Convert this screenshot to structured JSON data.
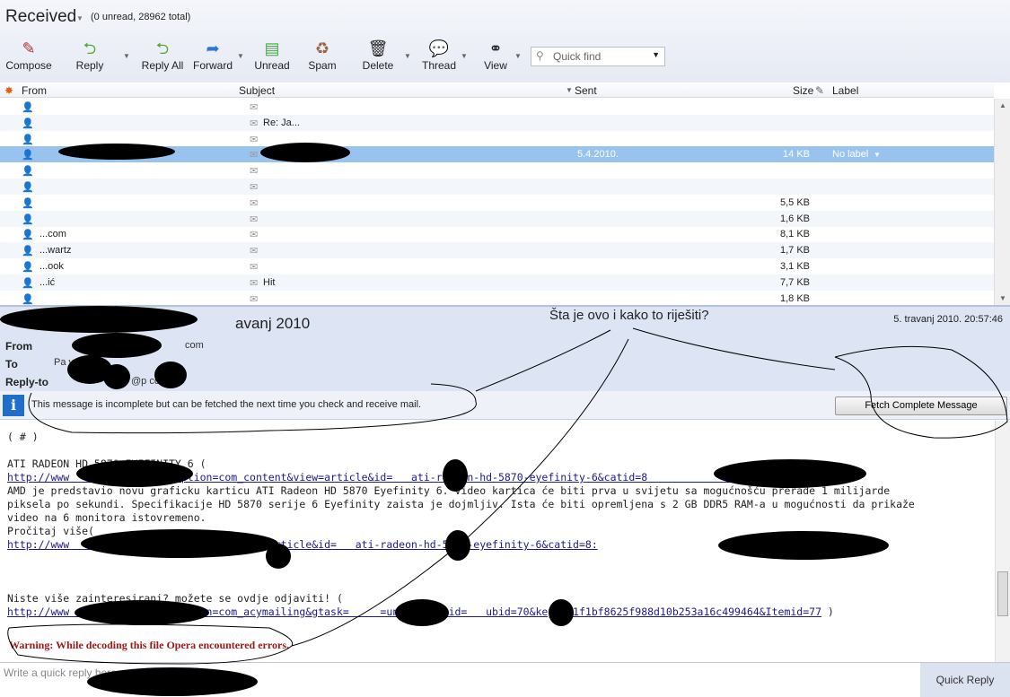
{
  "folder": {
    "title": "Received",
    "count": "(0 unread, 28962 total)"
  },
  "toolbar": [
    {
      "label": "Compose",
      "icon": "✎"
    },
    {
      "label": "Reply",
      "icon": "⮌"
    },
    {
      "label": "Reply All",
      "icon": "⮌"
    },
    {
      "label": "Forward",
      "icon": "➦"
    },
    {
      "label": "Unread",
      "icon": "▤"
    },
    {
      "label": "Spam",
      "icon": "♻"
    },
    {
      "label": "Delete",
      "icon": "🗑"
    },
    {
      "label": "Thread",
      "icon": "💬"
    },
    {
      "label": "View",
      "icon": "⚭"
    }
  ],
  "quickfind": {
    "placeholder": "Quick find"
  },
  "columns": {
    "from": "From",
    "subject": "Subject",
    "sent": "Sent",
    "size": "Size",
    "label": "Label"
  },
  "messages": [
    {
      "from": "",
      "subject": "",
      "sent": "",
      "size": ""
    },
    {
      "from": "",
      "subject": "Re: Ja...",
      "sent": "",
      "size": ""
    },
    {
      "from": "",
      "subject": "",
      "sent": "",
      "size": ""
    },
    {
      "from": "",
      "subject": "5 Travanj 2010",
      "sent": "5.4.2010.",
      "size": "14 KB",
      "label": "No label"
    },
    {
      "from": "",
      "subject": "",
      "sent": "",
      "size": ""
    },
    {
      "from": "",
      "subject": "",
      "sent": "",
      "size": ""
    },
    {
      "from": "",
      "subject": "",
      "sent": "",
      "size": "5,5 KB"
    },
    {
      "from": "",
      "subject": "",
      "sent": "",
      "size": "1,6 KB"
    },
    {
      "from": "...com",
      "subject": "",
      "sent": "",
      "size": "8,1 KB"
    },
    {
      "from": "...wartz",
      "subject": "",
      "sent": "",
      "size": "1,7 KB"
    },
    {
      "from": "...ook",
      "subject": "",
      "sent": "",
      "size": "3,1 KB"
    },
    {
      "from": "...ić",
      "subject": "Hit",
      "sent": "",
      "size": "7,7 KB"
    },
    {
      "from": "",
      "subject": "",
      "sent": "",
      "size": "1,8 KB"
    }
  ],
  "reader": {
    "subject": "avanj 2010",
    "date": "5. travanj 2010. 20:57:46",
    "from_label": "From",
    "from": "com",
    "to_label": "To",
    "to": "Pa v",
    "replyto_label": "Reply-to",
    "replyto": "@p      com"
  },
  "annotation": "Šta je ovo i kako to riješiti?",
  "info": {
    "text": "This message is incomplete but can be fetched the next time you check and receive mail.",
    "button": "Fetch Complete Message"
  },
  "body": {
    "l1": "( # )",
    "l2": "ATI RADEON HD 5870 EYEFINITY 6 (",
    "link1": "http://www              hp?option=com_content&view=article&id=   ati-radeon-hd-5870-eyefinity-6&catid=8              )",
    "l3": "AMD je predstavio novu graficku karticu ATI Radeon HD 5870 Eyefinity 6. Video kartica će biti prva u svijetu sa mogućnošću prerade 1 milijarde",
    "l4": "piksela po sekundi. Specifikacije HD 5870 serije 6 Eyefinity zaista je dojmljiv. Ista će biti opremljena s 2 GB DDR5 RAM-a u mogućnosti da prikaže",
    "l5": "video na 6 monitora istovremeno.",
    "l6": "Pročitaj više(",
    "link2": "http://www              =com_content&view=article&id=   ati-radeon-hd-5870-eyefinity-6&catid=8:",
    "l7": "Niste više zainteresirani? možete se ovdje odjaviti! (",
    "link3": "http://www              hp?option=com_acymailing&gtask=     =unsub&mailid=   ubid=70&key=901f1bf8625f988d10b253a16c499464&Itemid=77",
    "l8": " )",
    "warning": "Warning: While decoding this file Opera encountered errors."
  },
  "quickreply": {
    "placeholder": "Write a quick reply          here",
    "button": "Quick Reply"
  }
}
